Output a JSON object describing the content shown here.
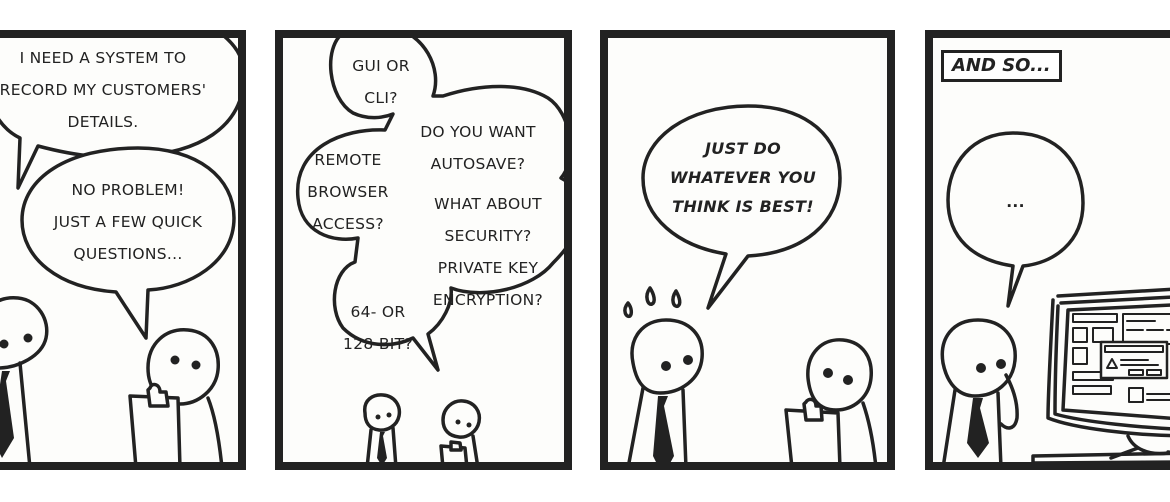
{
  "comic": {
    "panels": [
      {
        "index": 1,
        "bubbles": [
          {
            "speaker": "client",
            "lines": [
              "I NEED A SYSTEM TO",
              "RECORD MY CUSTOMERS'",
              "DETAILS."
            ]
          },
          {
            "speaker": "developer",
            "lines": [
              "NO PROBLEM!",
              "JUST A FEW QUICK",
              "QUESTIONS..."
            ]
          }
        ]
      },
      {
        "index": 2,
        "bubbles": [
          {
            "speaker": "developer",
            "lines": [
              "GUI OR",
              "CLI?"
            ]
          },
          {
            "speaker": "developer",
            "lines": [
              "REMOTE",
              "BROWSER",
              "ACCESS?"
            ]
          },
          {
            "speaker": "developer",
            "lines": [
              "DO YOU WANT",
              "AUTOSAVE?"
            ]
          },
          {
            "speaker": "developer",
            "lines": [
              "WHAT ABOUT",
              "SECURITY?",
              "PRIVATE KEY",
              "ENCRYPTION?"
            ]
          },
          {
            "speaker": "developer",
            "lines": [
              "64- OR",
              "128-BIT?"
            ]
          }
        ]
      },
      {
        "index": 3,
        "bubbles": [
          {
            "speaker": "client",
            "lines": [
              "JUST DO",
              "WHATEVER YOU",
              "THINK IS BEST!"
            ]
          }
        ]
      },
      {
        "index": 4,
        "caption": "AND SO...",
        "bubbles": [
          {
            "speaker": "client",
            "lines": [
              "..."
            ]
          }
        ],
        "screen_dialog_icon": "warning-triangle-icon"
      }
    ],
    "colors": {
      "ink": "#222222",
      "paper": "#fdfdfb"
    }
  }
}
